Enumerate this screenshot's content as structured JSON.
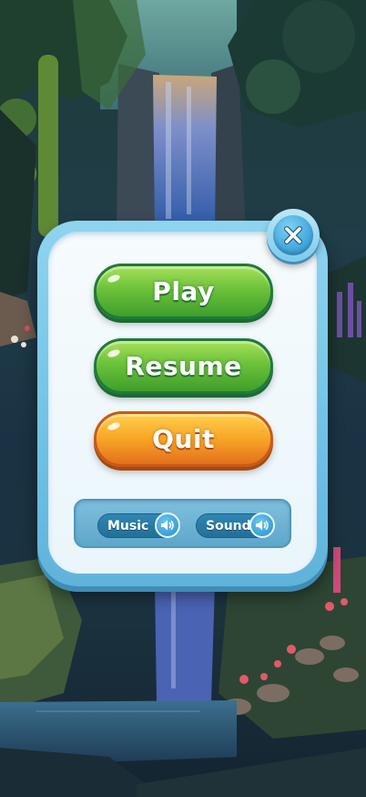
{
  "menu": {
    "play_label": "Play",
    "resume_label": "Resume",
    "quit_label": "Quit"
  },
  "audio": {
    "music_label": "Music",
    "sound_label": "Sound",
    "music_on": true,
    "sound_on": true
  },
  "icons": {
    "close": "close-icon",
    "music_toggle": "speaker-icon",
    "sound_toggle": "speaker-icon"
  },
  "colors": {
    "button_green": "#6cc23a",
    "button_orange": "#f7a526",
    "dialog_frame": "#6ec2e6",
    "dialog_panel": "#f3fafd",
    "settings_bar": "#6aafd0",
    "toggle": "#2a7aa6"
  }
}
